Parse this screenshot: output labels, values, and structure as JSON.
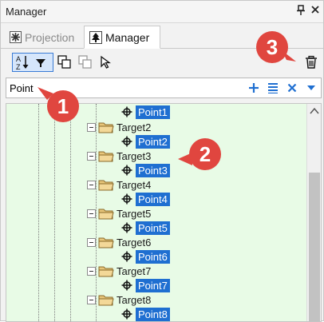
{
  "window": {
    "title": "Manager"
  },
  "titlebar_buttons": {
    "pin": "⊥",
    "close": "✕"
  },
  "tabs": [
    {
      "label": "Projection",
      "icon": "gear-asterisk-icon",
      "active": false
    },
    {
      "label": "Manager",
      "icon": "tree-icon",
      "active": true
    }
  ],
  "toolbar": {
    "sort_icon": "sort-az-icon",
    "filter_icon": "funnel-icon",
    "copy_icon": "copy-icon",
    "paste_icon": "paste-icon",
    "select_icon": "cursor-icon",
    "trash_icon": "trash-icon"
  },
  "filter": {
    "value": "Point",
    "add_icon": "plus-icon",
    "list_icon": "list-icon",
    "clear_icon": "close-icon",
    "dropdown_icon": "chevron-down-icon"
  },
  "tree": {
    "top_point": "Point1",
    "targets": [
      {
        "label": "Target2",
        "point": "Point2"
      },
      {
        "label": "Target3",
        "point": "Point3"
      },
      {
        "label": "Target4",
        "point": "Point4"
      },
      {
        "label": "Target5",
        "point": "Point5"
      },
      {
        "label": "Target6",
        "point": "Point6"
      },
      {
        "label": "Target7",
        "point": "Point7"
      },
      {
        "label": "Target8",
        "point": "Point8"
      }
    ]
  },
  "callouts": [
    "1",
    "2",
    "3"
  ],
  "colors": {
    "selection": "#1f6fd1",
    "tree_bg": "#e8fbe6",
    "callout": "#e0463f"
  }
}
